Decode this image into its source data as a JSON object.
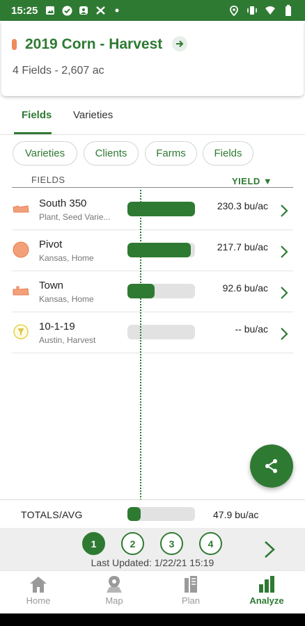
{
  "status_bar": {
    "time": "15:25",
    "left_icons": [
      "image-icon",
      "check-circle-icon",
      "photo-icon",
      "tractor-icon",
      "dot-icon"
    ],
    "right_icons": [
      "location-icon",
      "vibrate-icon",
      "wifi-icon",
      "battery-icon"
    ]
  },
  "header": {
    "title": "2019 Corn - Harvest",
    "subtitle": "4 Fields - 2,607 ac",
    "accent_color": "#f08a5d"
  },
  "tabs": [
    {
      "label": "Fields",
      "active": true
    },
    {
      "label": "Varieties",
      "active": false
    }
  ],
  "chips": [
    "Varieties",
    "Clients",
    "Farms",
    "Fields"
  ],
  "columns": {
    "fields": "FIELDS",
    "yield": "YIELD",
    "sort_arrow": "▼"
  },
  "rows": [
    {
      "name": "South 350",
      "sub": "Plant, Seed Varie...",
      "yield": "230.3 bu/ac",
      "fill": 1.0,
      "icon": "field-shape-icon"
    },
    {
      "name": "Pivot",
      "sub": "Kansas, Home",
      "yield": "217.7 bu/ac",
      "fill": 0.94,
      "icon": "pivot-circle-icon"
    },
    {
      "name": "Town",
      "sub": "Kansas, Home",
      "yield": "92.6 bu/ac",
      "fill": 0.4,
      "icon": "field-shape-icon"
    },
    {
      "name": "10-1-19",
      "sub": "Austin, Harvest",
      "yield": "-- bu/ac",
      "fill": 0.0,
      "icon": "warning-circle-icon"
    }
  ],
  "totals": {
    "label": "TOTALS/AVG",
    "yield": "47.9 bu/ac",
    "fill": 0.2
  },
  "pager": {
    "pages": [
      "1",
      "2",
      "3",
      "4"
    ],
    "active": 0,
    "last_updated": "Last Updated: 1/22/21 15:19"
  },
  "nav": [
    {
      "label": "Home",
      "icon": "home-icon",
      "active": false
    },
    {
      "label": "Map",
      "icon": "map-pin-icon",
      "active": false
    },
    {
      "label": "Plan",
      "icon": "plan-icon",
      "active": false
    },
    {
      "label": "Analyze",
      "icon": "analyze-icon",
      "active": true
    }
  ],
  "colors": {
    "brand": "#2f7a33",
    "inactive": "#9a9a9a"
  }
}
